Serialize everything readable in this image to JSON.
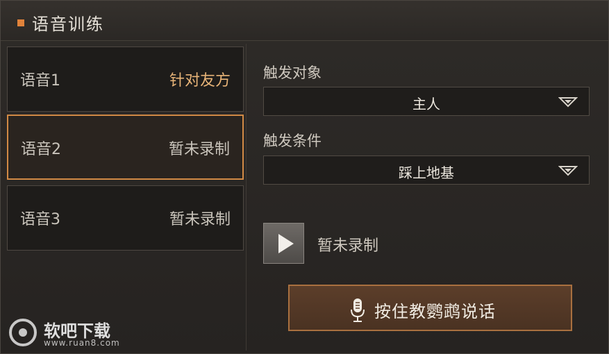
{
  "header": {
    "title": "语音训练"
  },
  "voices": [
    {
      "name": "语音1",
      "status": "针对友方"
    },
    {
      "name": "语音2",
      "status": "暂未录制"
    },
    {
      "name": "语音3",
      "status": "暂未录制"
    }
  ],
  "trigger_target": {
    "label": "触发对象",
    "value": "主人"
  },
  "trigger_condition": {
    "label": "触发条件",
    "value": "踩上地基"
  },
  "playback": {
    "status": "暂未录制"
  },
  "talk_button": {
    "label": "按住教鹦鹉说话"
  },
  "watermark": {
    "name": "软吧下载",
    "url": "www.ruan8.com"
  },
  "colors": {
    "accent": "#e0823a",
    "selected_border": "#d28a45",
    "talk_border": "#a9703f"
  }
}
